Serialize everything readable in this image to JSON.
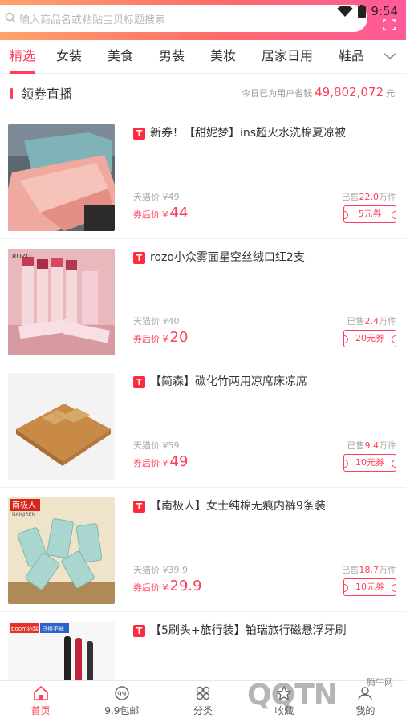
{
  "status": {
    "time": "9:54",
    "wifi_icon": "wifi-icon",
    "battery_icon": "battery-icon"
  },
  "search": {
    "placeholder": "输入商品名或粘贴宝贝标题搜索"
  },
  "tabs": [
    {
      "label": "精选",
      "active": true
    },
    {
      "label": "女装"
    },
    {
      "label": "美食"
    },
    {
      "label": "男装"
    },
    {
      "label": "美妆"
    },
    {
      "label": "居家日用"
    },
    {
      "label": "鞋品"
    }
  ],
  "section": {
    "title": "领券直播",
    "saving_label": "今日已为用户省钱",
    "saving_amount": "49,802,072",
    "unit": "元"
  },
  "labels": {
    "orig_prefix": "天猫价 ¥",
    "after_prefix": "券后价 ¥",
    "sold_prefix": "已售",
    "sold_unit": "万件"
  },
  "products": [
    {
      "title": "新券！【甜妮梦】ins超火水洗棉夏凉被",
      "orig": "49",
      "price": "44",
      "sold": "22.0",
      "coupon": "5元券"
    },
    {
      "title": "rozo小众雾面星空丝绒口红2支",
      "orig": "40",
      "price": "20",
      "sold": "2.4",
      "coupon": "20元券"
    },
    {
      "title": "【简森】碳化竹两用凉席床凉席",
      "orig": "59",
      "price": "49",
      "sold": "9.4",
      "coupon": "10元券"
    },
    {
      "title": "【南极人】女士纯棉无痕内裤9条装",
      "orig": "39.9",
      "price": "29.9",
      "sold": "18.7",
      "coupon": "10元券"
    },
    {
      "title": "【5刷头+旅行装】铂瑞旅行磁悬浮牙刷"
    }
  ],
  "thumb_text": {
    "rozo": "ROZO",
    "nanji": "南极人",
    "nanji_sub": "NANJIREN",
    "boom": "boom铂瑞",
    "swap": "只换不修"
  },
  "bottom_nav": [
    {
      "label": "首页",
      "icon": "home-icon",
      "active": true
    },
    {
      "label": "9.9包邮",
      "icon": "nine-nine-icon"
    },
    {
      "label": "分类",
      "icon": "category-icon"
    },
    {
      "label": "收藏",
      "icon": "star-icon"
    },
    {
      "label": "我的",
      "icon": "user-icon"
    }
  ],
  "watermark": {
    "logo": "QQTN",
    "site": "腾牛网"
  },
  "colors": {
    "accent": "#ff3d5a",
    "header_from": "#ffa36a",
    "header_to": "#ff5a9a",
    "tmall": "#ff2a3c"
  }
}
